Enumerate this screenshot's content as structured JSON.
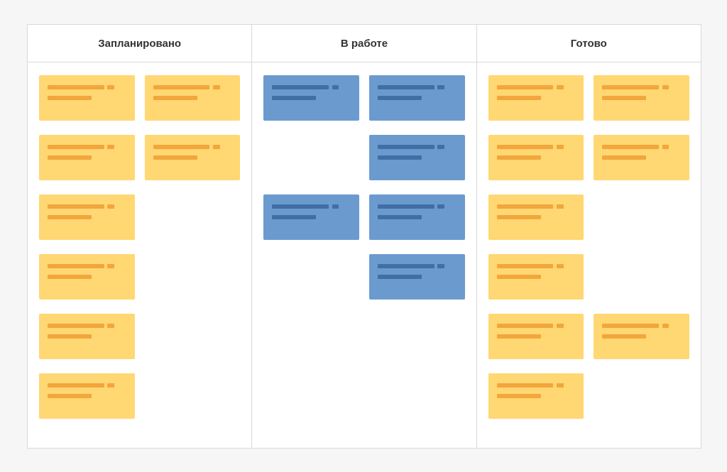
{
  "columns": [
    {
      "id": "planned",
      "title": "Запланировано",
      "color": "yellow",
      "slots": [
        true,
        true,
        true,
        true,
        true,
        false,
        true,
        false,
        true,
        false,
        true,
        false
      ]
    },
    {
      "id": "in_progress",
      "title": "В работе",
      "color": "blue",
      "slots": [
        true,
        true,
        false,
        true,
        true,
        true,
        false,
        true
      ]
    },
    {
      "id": "done",
      "title": "Готово",
      "color": "yellow",
      "slots": [
        true,
        true,
        true,
        true,
        true,
        false,
        true,
        false,
        true,
        true,
        true,
        false
      ]
    }
  ]
}
